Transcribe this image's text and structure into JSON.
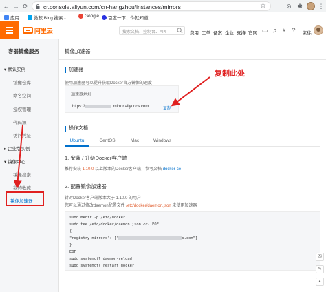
{
  "browser": {
    "url": "cr.console.aliyun.com/cn-hangzhou/instances/mirrors",
    "bookmarks": [
      "应用",
      "微软 Bing 搜索 - ...",
      "Google",
      "百度一下，你就知道"
    ]
  },
  "topbar": {
    "logo_text": "阿里云",
    "search_placeholder": "搜索文档、控制台、API",
    "nav": [
      "费用",
      "工单",
      "备案",
      "企业",
      "支持",
      "官网"
    ],
    "username": "紫徐"
  },
  "sidebar": {
    "title": "容器镜像服务",
    "groups": [
      {
        "label": "默认实例",
        "items": [
          "镜像仓库",
          "命名空间",
          "授权管理",
          "代码源",
          "访问凭证"
        ]
      },
      {
        "label": "企业版实例",
        "items": []
      },
      {
        "label": "镜像中心",
        "items": [
          "镜像搜索",
          "我的收藏",
          "镜像加速器"
        ]
      }
    ],
    "active_item": "镜像加速器"
  },
  "main": {
    "title": "镜像加速器",
    "accelerator": {
      "section": "加速器",
      "description": "使用加速器可以提升获取Docker官方镜像的速度",
      "label": "加速器地址",
      "url_prefix": "https://",
      "url_suffix": ".mirror.aliyuncs.com",
      "copy_label": "复制"
    },
    "annotation": "复制此处",
    "docs": {
      "section": "操作文档",
      "tabs": [
        "Ubuntu",
        "CentOS",
        "Mac",
        "Windows"
      ],
      "active_tab": "Ubuntu",
      "step1_title": "1. 安装 / 升级Docker客户端",
      "step1_pre": "推荐安装 ",
      "step1_version": "1.10.0",
      "step1_mid": " 以上版本的Docker客户端，参考文档 ",
      "step1_link": "docker-ce",
      "step2_title": "2. 配置镜像加速器",
      "step2_line1": "针对Docker客户端版本大于 1.10.0 的用户",
      "step2_pre": "您可以通过修改daemon配置文件 ",
      "step2_path": "/etc/docker/daemon.json",
      "step2_post": " 来使用加速器",
      "code_lines": [
        "sudo mkdir -p /etc/docker",
        "sudo tee /etc/docker/daemon.json <<-'EOF'",
        "{",
        "  \"registry-mirrors\": [\"",
        "}",
        "EOF",
        "sudo systemctl daemon-reload",
        "sudo systemctl restart docker"
      ],
      "code_mirror_suffix": "s.com\"]"
    }
  },
  "colors": {
    "accent": "#ff6a00",
    "link": "#0070cc",
    "annotation": "#e02020"
  },
  "icons": [
    "back-icon",
    "forward-icon",
    "reload-icon",
    "lock-icon",
    "star-icon",
    "search-icon",
    "menu-icon"
  ]
}
